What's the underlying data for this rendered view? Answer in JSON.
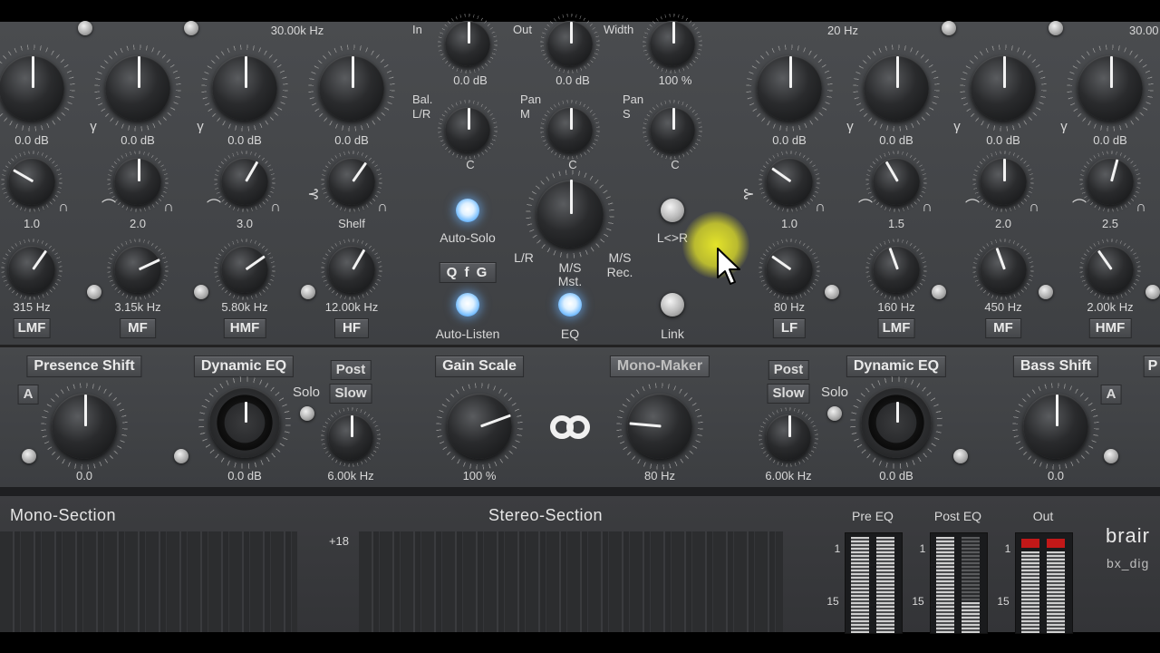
{
  "eq_top": {
    "freq_left": "30.00k Hz",
    "freq_right_low": "20 Hz",
    "freq_right_high": "30.00"
  },
  "mono_eq": {
    "gains": [
      "0.0 dB",
      "0.0 dB",
      "0.0 dB",
      "0.0 dB"
    ],
    "q": [
      "1.0",
      "2.0",
      "3.0",
      "Shelf"
    ],
    "freqs": [
      "315 Hz",
      "3.15k Hz",
      "5.80k Hz",
      "12.00k Hz"
    ],
    "bands": [
      "LMF",
      "MF",
      "HMF",
      "HF"
    ]
  },
  "stereo_eq": {
    "gains": [
      "0.0 dB",
      "0.0 dB",
      "0.0 dB",
      "0.0 dB"
    ],
    "q": [
      "1.0",
      "1.5",
      "2.0",
      "2.5"
    ],
    "freqs": [
      "80 Hz",
      "160 Hz",
      "450 Hz",
      "2.00k Hz"
    ],
    "bands": [
      "LF",
      "LMF",
      "MF",
      "HMF"
    ]
  },
  "center": {
    "in_label": "In",
    "in_value": "0.0 dB",
    "out_label": "Out",
    "out_value": "0.0 dB",
    "width_label": "Width",
    "width_value": "100 %",
    "bal_label_1": "Bal.",
    "bal_label_2": "L/R",
    "bal_value": "C",
    "panm_label_1": "Pan",
    "panm_label_2": "M",
    "panm_value": "C",
    "pans_label_1": "Pan",
    "pans_label_2": "S",
    "pans_value": "C",
    "auto_solo": "Auto-Solo",
    "qfg": "Q f G",
    "auto_listen": "Auto-Listen",
    "mode_lr": "L/R",
    "mode_msmst_1": "M/S",
    "mode_msmst_2": "Mst.",
    "mode_msrec_1": "M/S",
    "mode_msrec_2": "Rec.",
    "eq": "EQ",
    "swap": "L<>R",
    "link": "Link"
  },
  "dynamics": {
    "presence_shift": "Presence Shift",
    "presence_a": "A",
    "presence_value": "0.0",
    "dyn_eq_left": "Dynamic EQ",
    "dyn_eq_left_value": "0.0 dB",
    "solo_left": "Solo",
    "post_left": "Post",
    "slow_left": "Slow",
    "freq_left": "6.00k Hz",
    "gain_scale": "Gain Scale",
    "gain_scale_value": "100 %",
    "mono_maker": "Mono-Maker",
    "mono_maker_value": "80 Hz",
    "post_right": "Post",
    "slow_right": "Slow",
    "solo_right": "Solo",
    "freq_right": "6.00k Hz",
    "dyn_eq_right": "Dynamic EQ",
    "dyn_eq_right_value": "0.0 dB",
    "bass_shift": "Bass Shift",
    "bass_a": "A",
    "bass_value": "0.0",
    "edge_button": "P"
  },
  "meters": {
    "mono_section": "Mono-Section",
    "stereo_section": "Stereo-Section",
    "scale_top": "+18",
    "pre_eq": "Pre EQ",
    "post_eq": "Post EQ",
    "out": "Out",
    "tick_1": "1",
    "tick_15": "15",
    "brand_1": "brair",
    "brand_2": "bx_dig"
  },
  "cursor_highlight_color": "#e6e62a",
  "led_color": "#7fc2ff"
}
